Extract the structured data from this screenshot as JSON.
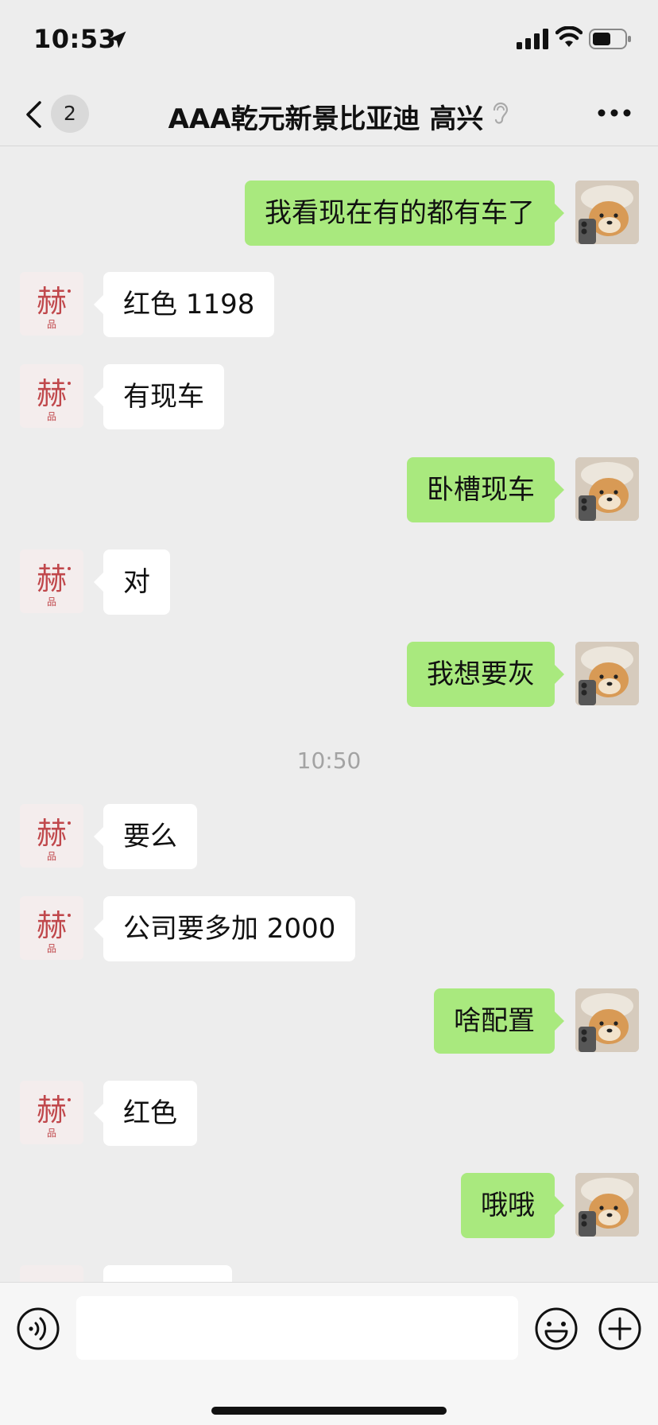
{
  "status_bar": {
    "time": "10:53"
  },
  "header": {
    "back_badge": "2",
    "title": "AAA乾元新景比亚迪  高兴"
  },
  "messages": [
    {
      "side": "self",
      "text": "我看现在有的都有车了"
    },
    {
      "side": "other",
      "text": "红色 1198"
    },
    {
      "side": "other",
      "text": "有现车"
    },
    {
      "side": "self",
      "text": "卧槽现车"
    },
    {
      "side": "other",
      "text": "对"
    },
    {
      "side": "self",
      "text": "我想要灰"
    },
    {
      "timestamp": "10:50"
    },
    {
      "side": "other",
      "text": "要么"
    },
    {
      "side": "other",
      "text": "公司要多加 2000"
    },
    {
      "side": "self",
      "text": "啥配置"
    },
    {
      "side": "other",
      "text": "红色"
    },
    {
      "side": "self",
      "text": "哦哦"
    }
  ],
  "input": {
    "value": ""
  },
  "colors": {
    "self_bubble": "#a9e97e",
    "other_bubble": "#ffffff",
    "background": "#ededed"
  },
  "icons": {
    "location": "location-arrow-icon",
    "signal": "cellular-signal-icon",
    "wifi": "wifi-icon",
    "battery": "battery-icon",
    "back": "chevron-left-icon",
    "ear": "ear-icon",
    "more": "more-dots-icon",
    "voice": "voice-icon",
    "emoji": "emoji-icon",
    "plus": "plus-icon"
  }
}
